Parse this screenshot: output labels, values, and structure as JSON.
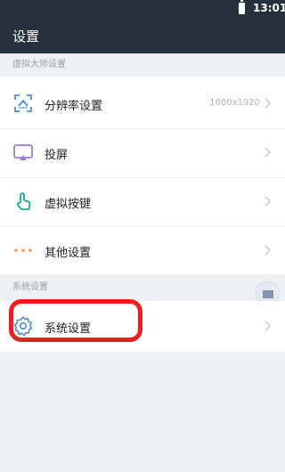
{
  "status_bar": {
    "time": "13:01",
    "battery_icon": "battery-full-icon"
  },
  "app_bar": {
    "title": "设置"
  },
  "sections": [
    {
      "header": "虚拟大师设置",
      "items": [
        {
          "label": "分辨率设置",
          "value": "1080x1920",
          "icon": "resolution-icon"
        },
        {
          "label": "投屏",
          "value": "",
          "icon": "screencast-icon"
        },
        {
          "label": "虚拟按键",
          "value": "",
          "icon": "touch-key-icon"
        },
        {
          "label": "其他设置",
          "value": "",
          "icon": "more-dots-icon"
        }
      ]
    },
    {
      "header": "系统设置",
      "items": [
        {
          "label": "系统设置",
          "value": "",
          "icon": "gear-icon"
        }
      ]
    }
  ],
  "floating_button": {
    "icon": "book-icon"
  },
  "colors": {
    "app_bar": "#26313d",
    "accent_blue": "#4a8fd8",
    "accent_teal": "#1aab8a",
    "accent_purple": "#9a7bd0",
    "accent_orange": "#f19a52",
    "highlight_red": "#f21d1d"
  }
}
